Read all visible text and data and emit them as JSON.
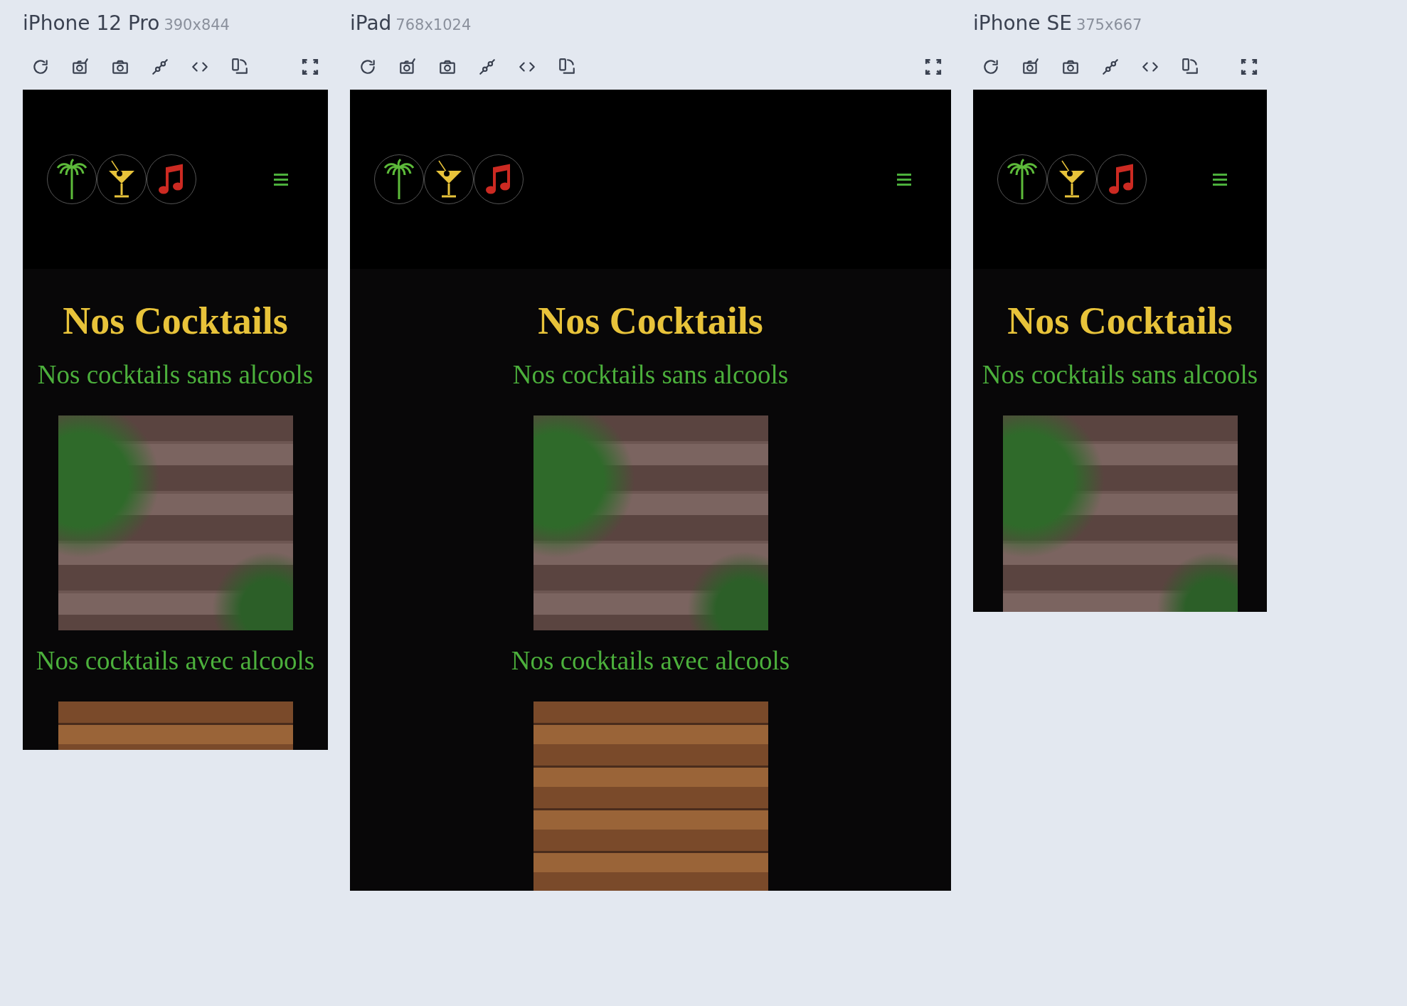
{
  "devices": [
    {
      "name": "iPhone 12 Pro",
      "size": "390x844",
      "page": {
        "title": "Nos Cocktails",
        "sections": [
          {
            "heading": "Nos cocktails sans alcools",
            "kind": "ivy"
          },
          {
            "heading": "Nos cocktails avec alcools",
            "kind": "planks"
          }
        ]
      }
    },
    {
      "name": "iPad",
      "size": "768x1024",
      "page": {
        "title": "Nos Cocktails",
        "sections": [
          {
            "heading": "Nos cocktails sans alcools",
            "kind": "ivy"
          },
          {
            "heading": "Nos cocktails avec alcools",
            "kind": "planks"
          }
        ]
      }
    },
    {
      "name": "iPhone SE",
      "size": "375x667",
      "page": {
        "title": "Nos Cocktails",
        "sections": [
          {
            "heading": "Nos cocktails sans alcools",
            "kind": "ivy"
          }
        ]
      }
    }
  ]
}
